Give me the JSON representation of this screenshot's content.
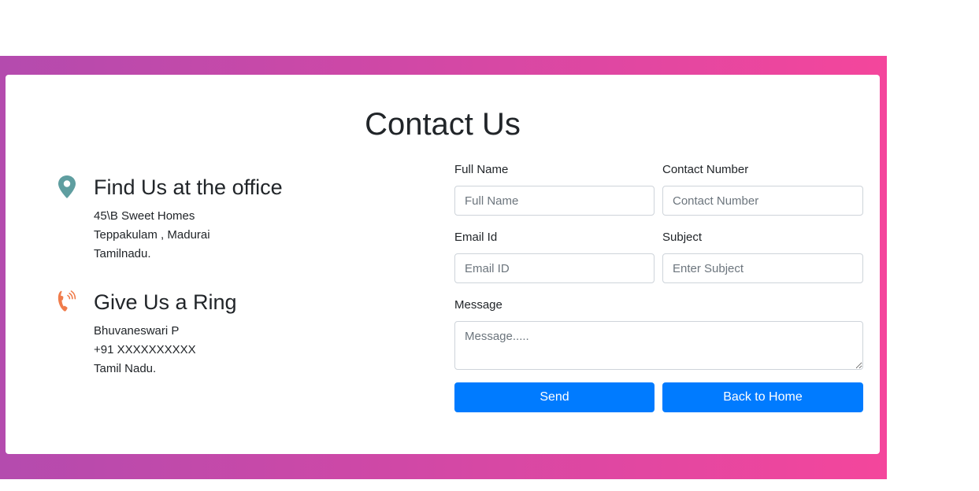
{
  "title": "Contact Us",
  "office": {
    "icon": "map-pin-icon",
    "heading": "Find Us at the office",
    "lines": [
      "45\\B Sweet Homes",
      "Teppakulam , Madurai",
      "Tamilnadu."
    ]
  },
  "ring": {
    "icon": "phone-ringing-icon",
    "heading": "Give Us a Ring",
    "lines": [
      "Bhuvaneswari P",
      "+91 XXXXXXXXXX",
      "Tamil Nadu."
    ]
  },
  "form": {
    "full_name": {
      "label": "Full Name",
      "placeholder": "Full Name",
      "value": ""
    },
    "contact_number": {
      "label": "Contact Number",
      "placeholder": "Contact Number",
      "value": ""
    },
    "email": {
      "label": "Email Id",
      "placeholder": "Email ID",
      "value": ""
    },
    "subject": {
      "label": "Subject",
      "placeholder": "Enter Subject",
      "value": ""
    },
    "message": {
      "label": "Message",
      "placeholder": "Message.....",
      "value": ""
    },
    "send_label": "Send",
    "back_label": "Back to Home"
  },
  "colors": {
    "gradient_start": "#b44bae",
    "gradient_end": "#f4469c",
    "button": "#007bff",
    "pin_icon": "#5f9ea0",
    "phone_icon": "#f07c4b"
  }
}
